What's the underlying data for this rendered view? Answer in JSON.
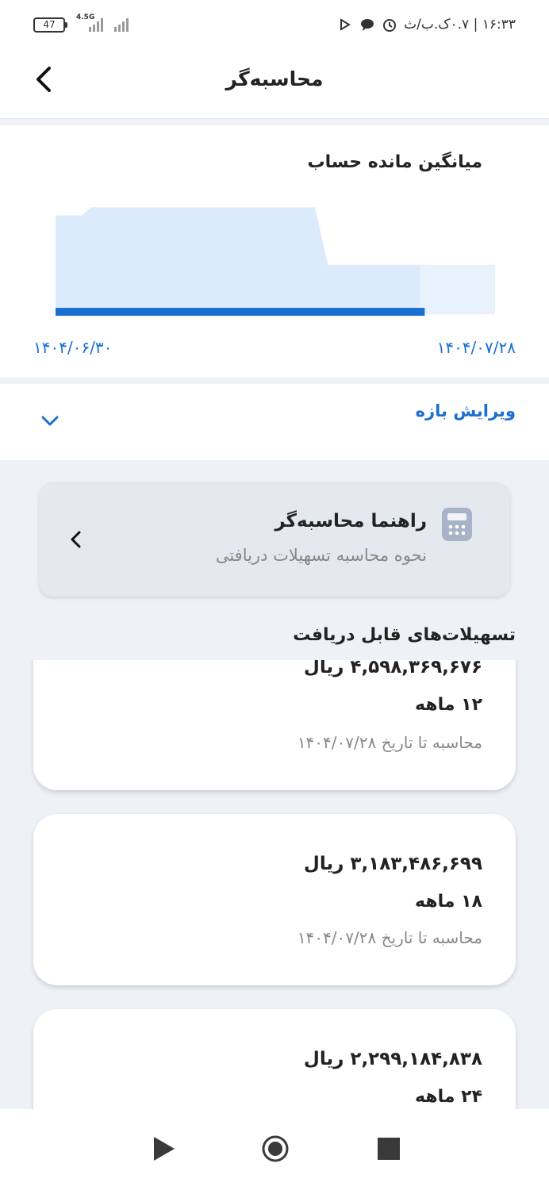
{
  "status_bar": {
    "time": "۱۶:۳۳ | ۰.۷ک.ب/ث",
    "battery": "47",
    "network": "4.5G"
  },
  "header": {
    "title": "محاسبه‌گر",
    "back_icon": "chevron-left-icon"
  },
  "chart_data": {
    "type": "area",
    "title": "میانگین مانده حساب",
    "x_labels": [
      "۱۴۰۴/۰۶/۳۰",
      "۱۴۰۴/۰۷/۲۸"
    ],
    "y_profile": [
      0.84,
      0.84,
      0.91,
      0.91,
      0.42,
      0.42,
      0.42
    ],
    "highlight_fraction": 0.84,
    "colors": {
      "area": "#dcebfb",
      "area_faded": "#e9f2fc",
      "progress": "#1a6fd1"
    }
  },
  "edit_range": {
    "label": "ویرایش بازه",
    "icon": "chevron-down-icon"
  },
  "guide": {
    "title": "راهنما محاسبه‌گر",
    "subtitle": "نحوه محاسبه تسهیلات دریافتی",
    "icon": "calculator-icon"
  },
  "loans_section": {
    "title": "تسهیلات‌های قابل دریافت"
  },
  "loans": [
    {
      "amount": "۴,۵۹۸,۳۶۹,۶۷۶ ریال",
      "term": "۱۲ ماهه",
      "date": "محاسبه تا تاریخ ۱۴۰۴/۰۷/۲۸"
    },
    {
      "amount": "۳,۱۸۳,۴۸۶,۶۹۹ ریال",
      "term": "۱۸ ماهه",
      "date": "محاسبه تا تاریخ ۱۴۰۴/۰۷/۲۸"
    },
    {
      "amount": "۲,۲۹۹,۱۸۴,۸۳۸ ریال",
      "term": "۲۴ ماهه",
      "date": ""
    }
  ],
  "nav": {
    "back": "play-triangle-icon",
    "home": "home-circle-icon",
    "recent": "square-icon"
  }
}
